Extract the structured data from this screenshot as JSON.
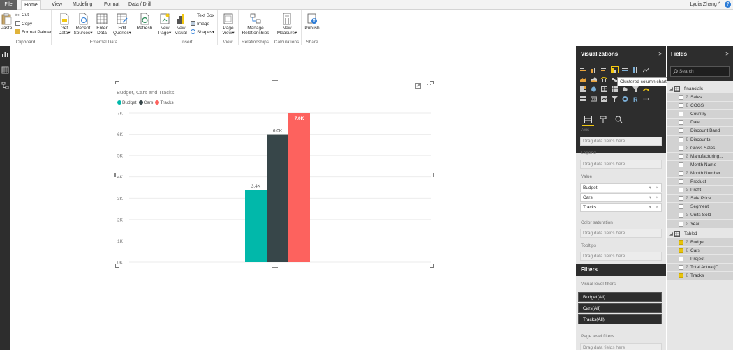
{
  "tabs": {
    "file": "File",
    "home": "Home",
    "view": "View",
    "modeling": "Modeling",
    "format": "Format",
    "datadrill": "Data / Drill"
  },
  "user": {
    "name": "Lydia Zhang",
    "help": "?"
  },
  "ribbon": {
    "paste": "Paste",
    "cut": "Cut",
    "copy": "Copy",
    "format_painter": "Format Painter",
    "clipboard": "Clipboard",
    "get_data": "Get Data",
    "recent_sources": "Recent Sources",
    "enter_data": "Enter Data",
    "edit_queries": "Edit Queries",
    "refresh": "Refresh",
    "external_data": "External Data",
    "new_page": "New Page",
    "new_visual": "New Visual",
    "text_box": "Text Box",
    "image": "Image",
    "shapes": "Shapes",
    "insert": "Insert",
    "page_view": "Page View",
    "view": "View",
    "manage_relationships": "Manage Relationships",
    "relationships": "Relationships",
    "new_measure": "New Measure",
    "calculations": "Calculations",
    "publish": "Publish",
    "share": "Share"
  },
  "visual": {
    "title": "Budget, Cars and Tracks"
  },
  "chart_data": {
    "type": "bar",
    "title": "Budget, Cars and Tracks",
    "categories": [
      ""
    ],
    "series": [
      {
        "name": "Budget",
        "values": [
          3400
        ],
        "label": "3.4K",
        "color": "#01b8aa"
      },
      {
        "name": "Cars",
        "values": [
          6000
        ],
        "label": "6.0K",
        "color": "#374649"
      },
      {
        "name": "Tracks",
        "values": [
          7000
        ],
        "label": "7.0K",
        "color": "#fd625e"
      }
    ],
    "yticks": [
      "0K",
      "1K",
      "2K",
      "3K",
      "4K",
      "5K",
      "6K",
      "7K"
    ],
    "ylim": [
      0,
      7000
    ],
    "legend": "top-left",
    "grid": true
  },
  "viz": {
    "header": "Visualizations",
    "tooltip": "Clustered column chart",
    "axis": "Axis",
    "axis_well": "Drag data fields here",
    "legend": "Legend",
    "legend_well": "Drag data fields here",
    "value": "Value",
    "value_fields": [
      "Budget",
      "Cars",
      "Tracks"
    ],
    "color_sat": "Color saturation",
    "color_well": "Drag data fields here",
    "tooltips": "Tooltips",
    "tooltips_well": "Drag data fields here",
    "filters": "Filters",
    "visual_level": "Visual level filters",
    "filter_items": [
      "Budget(All)",
      "Cars(All)",
      "Tracks(All)"
    ],
    "page_level": "Page level filters",
    "page_well": "Drag data fields here"
  },
  "fields": {
    "header": "Fields",
    "search": "Search",
    "table1_name": "financials",
    "financials": [
      {
        "name": "Sales",
        "sigma": true,
        "checked": false
      },
      {
        "name": "COGS",
        "sigma": true,
        "checked": false
      },
      {
        "name": "Country",
        "sigma": false,
        "checked": false
      },
      {
        "name": "Date",
        "sigma": false,
        "checked": false
      },
      {
        "name": "Discount Band",
        "sigma": false,
        "checked": false
      },
      {
        "name": "Discounts",
        "sigma": true,
        "checked": false
      },
      {
        "name": "Gross Sales",
        "sigma": true,
        "checked": false
      },
      {
        "name": "Manufacturing...",
        "sigma": true,
        "checked": false
      },
      {
        "name": "Month Name",
        "sigma": false,
        "checked": false
      },
      {
        "name": "Month Number",
        "sigma": true,
        "checked": false
      },
      {
        "name": "Product",
        "sigma": false,
        "checked": false
      },
      {
        "name": "Profit",
        "sigma": true,
        "checked": false
      },
      {
        "name": "Sale Price",
        "sigma": true,
        "checked": false
      },
      {
        "name": "Segment",
        "sigma": false,
        "checked": false
      },
      {
        "name": "Units Sold",
        "sigma": true,
        "checked": false
      },
      {
        "name": "Year",
        "sigma": true,
        "checked": false
      }
    ],
    "table2_name": "Table1",
    "table1": [
      {
        "name": "Budget",
        "sigma": true,
        "checked": true
      },
      {
        "name": "Cars",
        "sigma": true,
        "checked": true
      },
      {
        "name": "Project",
        "sigma": false,
        "checked": false
      },
      {
        "name": "Total Actual(C...",
        "sigma": true,
        "checked": false
      },
      {
        "name": "Tracks",
        "sigma": true,
        "checked": true
      }
    ]
  }
}
